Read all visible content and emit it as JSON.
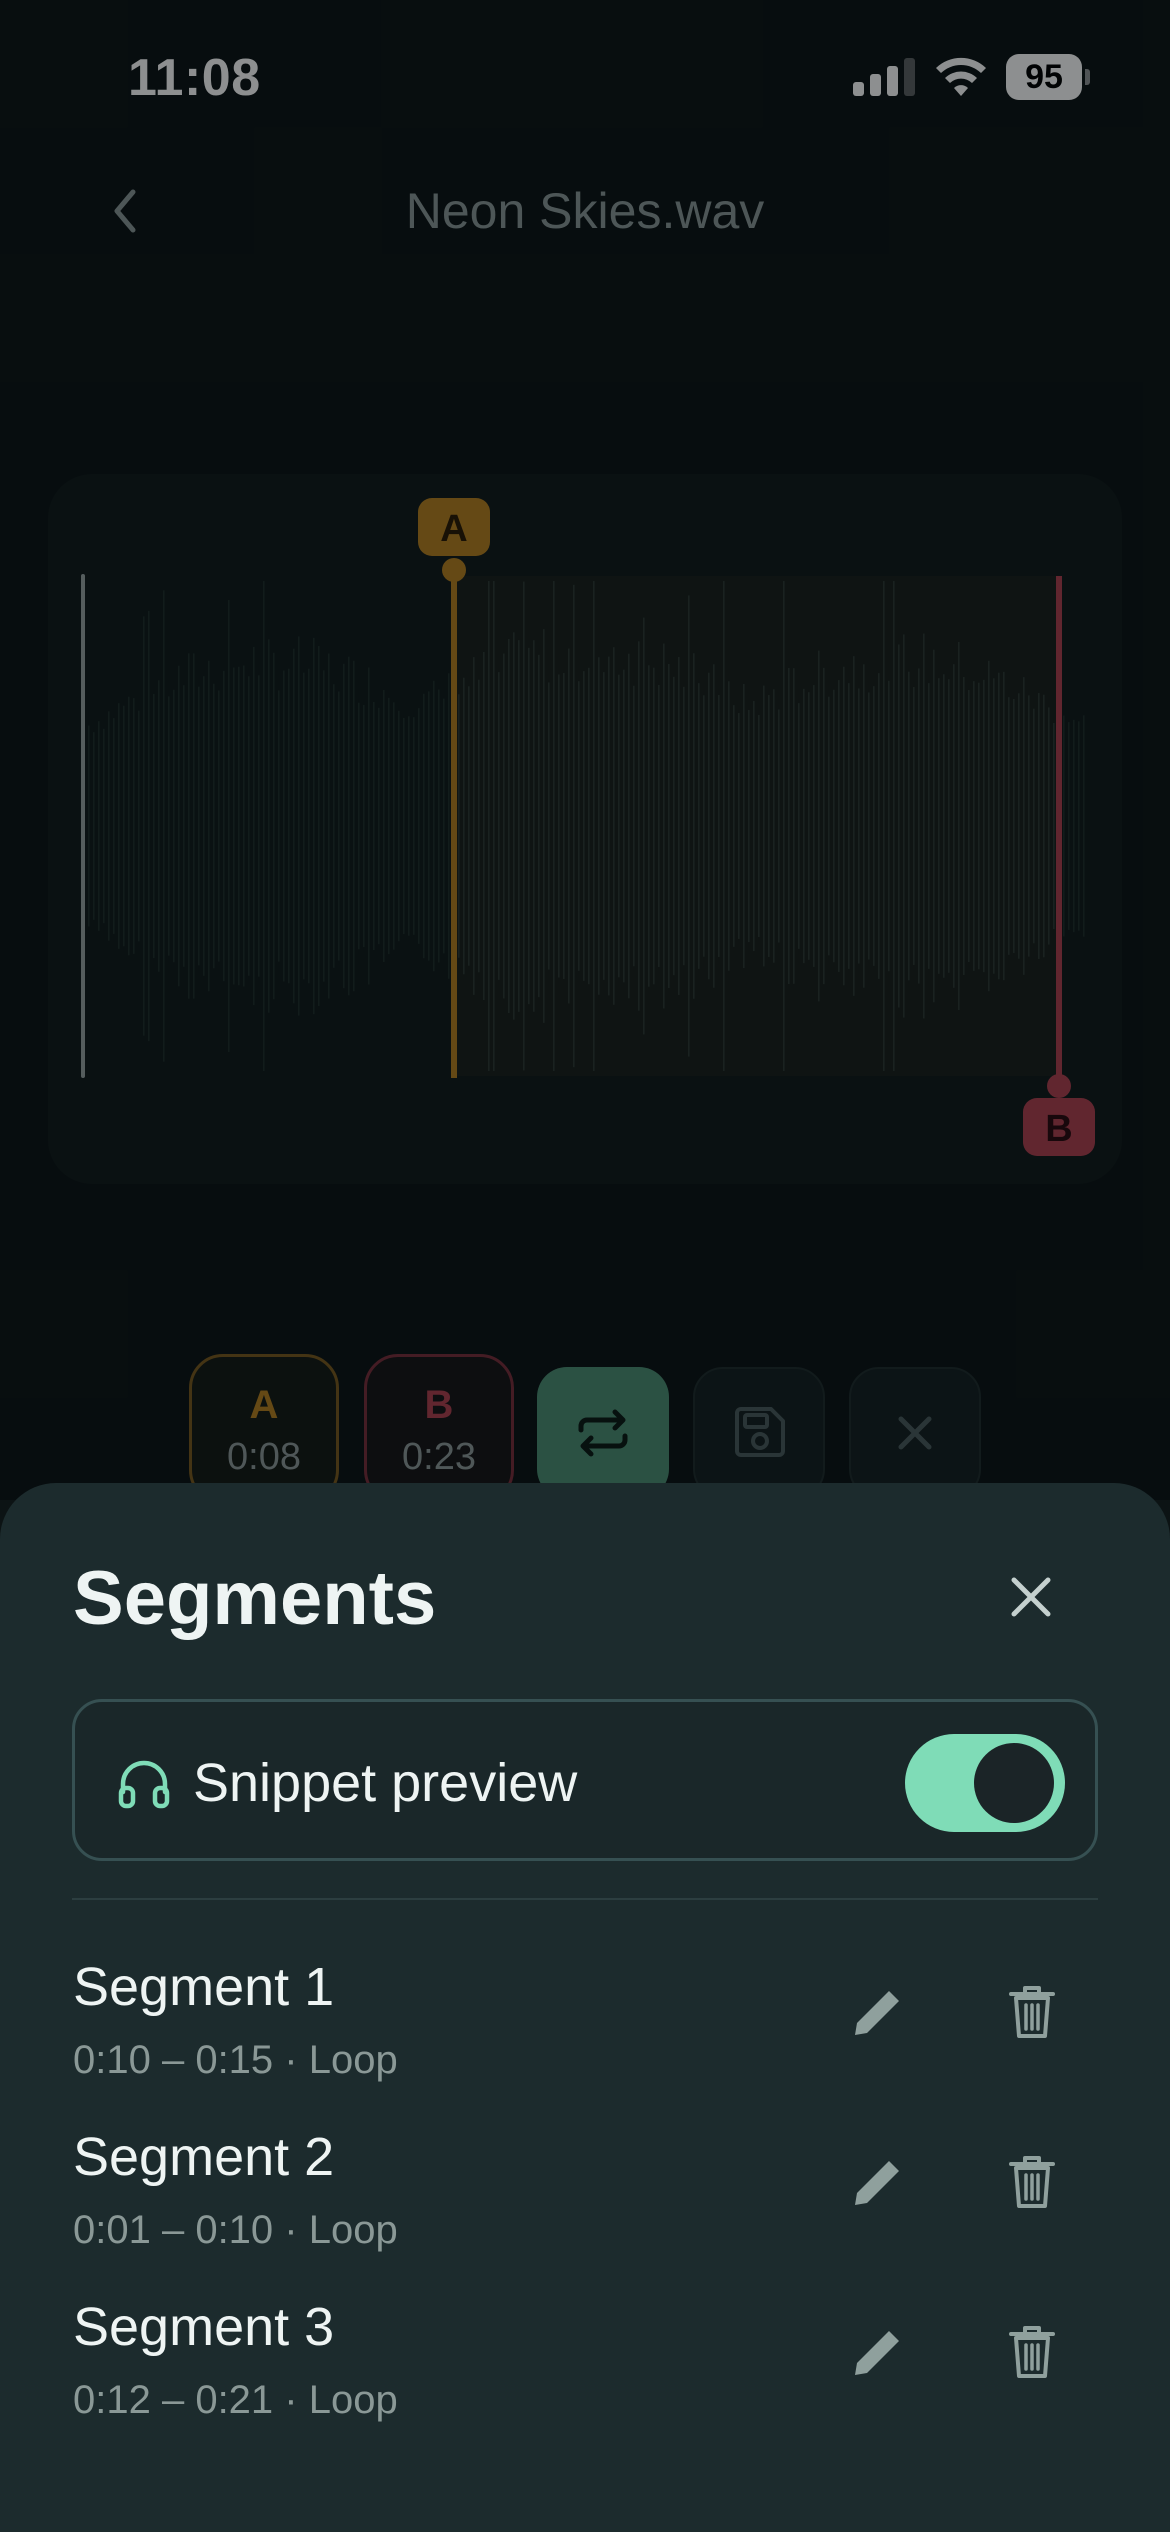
{
  "status_bar": {
    "time": "11:08",
    "battery": "95"
  },
  "nav": {
    "title": "Neon Skies.wav"
  },
  "waveform": {
    "marker_a_label": "A",
    "marker_b_label": "B",
    "marker_a_color": "#b7801f",
    "marker_b_color": "#b0404f"
  },
  "controls": {
    "a_label": "A",
    "a_time": "0:08",
    "b_label": "B",
    "b_time": "0:23",
    "loop_icon": "repeat-icon",
    "save_icon": "save-icon",
    "clear_icon": "close-icon"
  },
  "sheet": {
    "title": "Segments",
    "preview_label": "Snippet preview",
    "preview_enabled": true,
    "accent_color": "#7fdcb7",
    "segments": [
      {
        "name": "Segment 1",
        "meta": "0:10 – 0:15 · Loop"
      },
      {
        "name": "Segment 2",
        "meta": "0:01 – 0:10 · Loop"
      },
      {
        "name": "Segment 3",
        "meta": "0:12 – 0:21 · Loop"
      }
    ]
  }
}
